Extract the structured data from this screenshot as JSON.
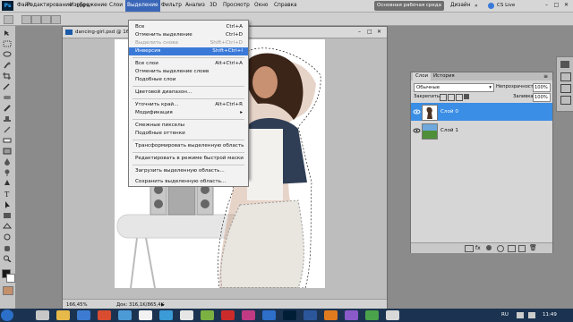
{
  "app": {
    "logo": "Ps"
  },
  "menubar": {
    "items": [
      "Файл",
      "Редактирование",
      "Изображение",
      "Слои",
      "Выделение",
      "Фильтр",
      "Анализ",
      "3D",
      "Просмотр",
      "Окно",
      "Справка"
    ],
    "zoom": "100%",
    "workspace": "Основная рабочая среда",
    "design": "Дизайн",
    "cslive": "CS Live"
  },
  "document": {
    "tab_title": "dancing-girl.psd @ 166",
    "status_zoom": "166,45%",
    "status_doc": "Док: 316,1K/865,4K"
  },
  "select_menu": {
    "items": [
      {
        "label": "Все",
        "shortcut": "Ctrl+A",
        "state": "normal"
      },
      {
        "label": "Отменить выделение",
        "shortcut": "Ctrl+D",
        "state": "normal"
      },
      {
        "label": "Выделить снова",
        "shortcut": "Shift+Ctrl+D",
        "state": "disabled"
      },
      {
        "label": "Инверсия",
        "shortcut": "Shift+Ctrl+I",
        "state": "highlighted"
      },
      {
        "label": "Все слои",
        "shortcut": "Alt+Ctrl+A",
        "state": "normal"
      },
      {
        "label": "Отменить выделение слоев",
        "shortcut": "",
        "state": "normal"
      },
      {
        "label": "Подобные слои",
        "shortcut": "",
        "state": "normal"
      },
      {
        "label": "Цветовой диапазон...",
        "shortcut": "",
        "state": "normal"
      },
      {
        "label": "Уточнить край...",
        "shortcut": "Alt+Ctrl+R",
        "state": "normal"
      },
      {
        "label": "Модификация",
        "shortcut": "",
        "state": "normal"
      },
      {
        "label": "Смежные пикселы",
        "shortcut": "",
        "state": "normal"
      },
      {
        "label": "Подобные оттенки",
        "shortcut": "",
        "state": "normal"
      },
      {
        "label": "Трансформировать выделенную область",
        "shortcut": "",
        "state": "normal"
      },
      {
        "label": "Редактировать в режиме быстрой маски",
        "shortcut": "",
        "state": "normal"
      },
      {
        "label": "Загрузить выделенную область...",
        "shortcut": "",
        "state": "normal"
      },
      {
        "label": "Сохранить выделенную область...",
        "shortcut": "",
        "state": "normal"
      }
    ]
  },
  "layers_panel": {
    "tabs": [
      "Слои",
      "История"
    ],
    "blend_mode": "Обычные",
    "opacity_label": "Непрозрачность:",
    "opacity_value": "100%",
    "lock_label": "Закрепить:",
    "fill_label": "Заливка:",
    "fill_value": "100%",
    "layers": [
      {
        "name": "Слой 0",
        "selected": true
      },
      {
        "name": "Слой 1",
        "selected": false
      }
    ]
  },
  "taskbar": {
    "lang": "RU",
    "time": "11:49"
  },
  "colors": {
    "accent": "#3a79d8",
    "menubar": "#d6d6d6",
    "taskbar": "#1b3351",
    "selected_layer": "#3a8ee6"
  }
}
